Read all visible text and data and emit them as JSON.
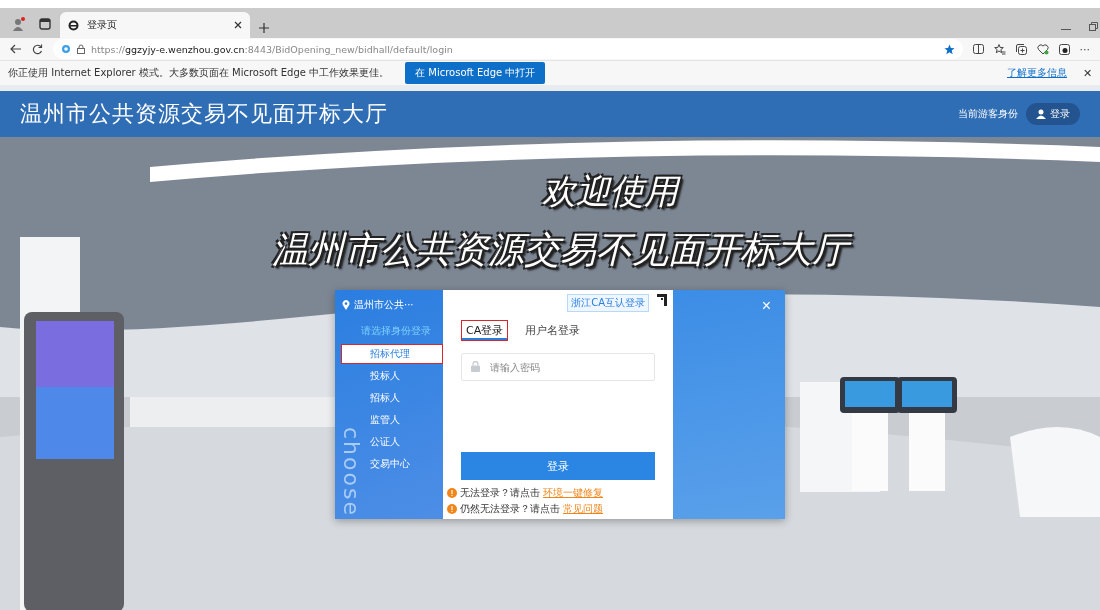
{
  "browser": {
    "tabs": [
      {
        "title": "登录页",
        "selected": true
      }
    ],
    "url": "https://**ggzyjy-e.wenzhou.gov.cn**:8443/BidOpening_new/bidhall/default/login",
    "favorited": true,
    "more": "···"
  },
  "ie_bar": {
    "message": "你正使用 Internet Explorer 模式。大多数页面在 Microsoft Edge 中工作效果更佳。",
    "button": "在 Microsoft Edge 中打开",
    "link": "了解更多信息",
    "close": "✕"
  },
  "header": {
    "title": "温州市公共资源交易不见面开标大厅",
    "guest_label": "当前游客身份",
    "login_button": "登录"
  },
  "hero": {
    "line1": "欢迎使用",
    "line2": "温州市公共资源交易不见面开标大厅"
  },
  "dialog": {
    "location": "温州市公共···",
    "prompt": "请选择身份登录",
    "side_text": "choose",
    "roles": [
      {
        "label": "招标代理",
        "selected": true,
        "highlighted": true
      },
      {
        "label": "投标人",
        "selected": false,
        "highlighted": false
      },
      {
        "label": "招标人",
        "selected": false,
        "highlighted": false
      },
      {
        "label": "监管人",
        "selected": false,
        "highlighted": false
      },
      {
        "label": "公证人",
        "selected": false,
        "highlighted": false
      },
      {
        "label": "交易中心",
        "selected": false,
        "highlighted": false
      }
    ],
    "mutual_login": "浙江CA互认登录",
    "tabs": [
      {
        "label": "CA登录",
        "selected": true,
        "highlighted": true
      },
      {
        "label": "用户名登录",
        "selected": false,
        "highlighted": false
      }
    ],
    "password": {
      "placeholder": "请输入密码"
    },
    "submit": "登录",
    "help": [
      {
        "text": "无法登录？请点击",
        "link": "环境一键修复"
      },
      {
        "text": "仍然无法登录？请点击",
        "link": "常见问题"
      }
    ],
    "close": "×"
  }
}
